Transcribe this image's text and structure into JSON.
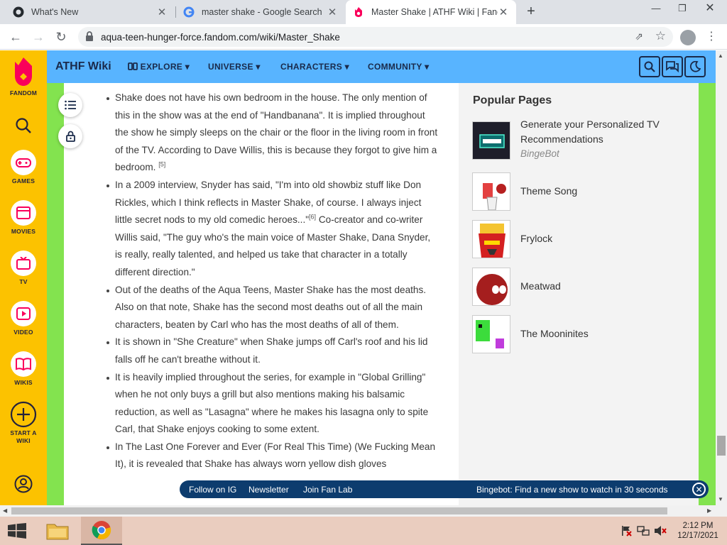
{
  "tabs": [
    {
      "title": "What's New",
      "icon": "github-icon"
    },
    {
      "title": "master shake - Google Search",
      "icon": "google-icon"
    },
    {
      "title": "Master Shake | ATHF Wiki | Fandom",
      "icon": "fandom-icon"
    }
  ],
  "new_tab_label": "+",
  "address": "aqua-teen-hunger-force.fandom.com/wiki/Master_Shake",
  "rail": [
    {
      "label": "FANDOM",
      "icon": "fandom-logo-icon"
    },
    {
      "label": "",
      "icon": "search-icon"
    },
    {
      "label": "GAMES",
      "icon": "gamepad-icon"
    },
    {
      "label": "MOVIES",
      "icon": "film-icon"
    },
    {
      "label": "TV",
      "icon": "tv-icon"
    },
    {
      "label": "VIDEO",
      "icon": "play-icon"
    },
    {
      "label": "WIKIS",
      "icon": "book-icon"
    },
    {
      "label": "START A WIKI",
      "icon": "plus-circle-icon"
    },
    {
      "label": "",
      "icon": "user-icon"
    }
  ],
  "header": {
    "wiki_name": "ATHF Wiki",
    "nav": [
      "EXPLORE",
      "UNIVERSE",
      "CHARACTERS",
      "COMMUNITY"
    ]
  },
  "article": {
    "items": [
      {
        "parts": [
          {
            "text": "Shake does not have his own bedroom in the house. The only mention of this in the show was at the end of \"Handbanana\". It is implied throughout the show he simply sleeps on the chair or the floor in the living room in front of the TV. According to Dave Willis, this is because they forgot to give him a bedroom. "
          },
          {
            "sup": "[5]"
          }
        ]
      },
      {
        "parts": [
          {
            "text": "In a 2009 interview, Snyder has said, \"I'm into old showbiz stuff like Don Rickles, which I think reflects in Master Shake, of course. I always inject little secret nods to my old comedic heroes...\""
          },
          {
            "sup": "[6]"
          },
          {
            "text": " Co-creator and co-writer Willis said, \"The guy who's the main voice of Master Shake, Dana Snyder, is really, really talented, and helped us take that character in a totally different direction.\""
          }
        ]
      },
      {
        "parts": [
          {
            "text": "Out of the deaths of the Aqua Teens, Master Shake has the most deaths. Also on that note, Shake has the second most deaths out of all the main characters, beaten by Carl who has the most deaths of all of them."
          }
        ]
      },
      {
        "parts": [
          {
            "text": "It is shown in \"She Creature\" when Shake jumps off Carl's roof and his lid falls off he can't breathe without it."
          }
        ]
      },
      {
        "parts": [
          {
            "text": "It is heavily implied throughout the series, for example in \"Global Grilling\" when he not only buys a grill but also mentions making his balsamic reduction, as well as \"Lasagna\" where he makes his lasagna only to spite Carl, that Shake enjoys cooking to some extent."
          }
        ]
      },
      {
        "parts": [
          {
            "text": "In The Last One Forever and Ever (For Real This Time) (We Fucking Mean It), it is revealed that Shake has always worn yellow dish gloves"
          }
        ]
      }
    ]
  },
  "sidebar": {
    "title": "Popular Pages",
    "pages": [
      {
        "title": "Generate your Personalized TV Recommendations",
        "subtitle": "BingeBot"
      },
      {
        "title": "Theme Song",
        "subtitle": ""
      },
      {
        "title": "Frylock",
        "subtitle": ""
      },
      {
        "title": "Meatwad",
        "subtitle": ""
      },
      {
        "title": "The Mooninites",
        "subtitle": ""
      }
    ]
  },
  "global_bar": {
    "links": [
      "Follow on IG",
      "Newsletter",
      "Join Fan Lab"
    ],
    "promo": "Bingebot: Find a new show to watch in 30 seconds"
  },
  "taskbar": {
    "time": "2:12 PM",
    "date": "12/17/2021"
  },
  "colors": {
    "rail": "#fcc200",
    "header": "#58b4ff",
    "page_bg": "#83e34f",
    "global_bar": "#0d3c6e",
    "taskbar": "#eacdbf"
  }
}
